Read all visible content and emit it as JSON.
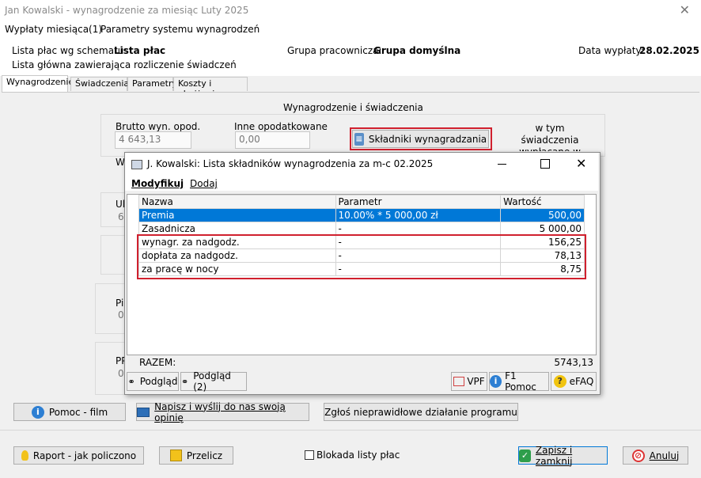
{
  "window": {
    "title": "Jan Kowalski - wynagrodzenie za miesiąc Luty 2025",
    "close_glyph": "✕"
  },
  "menu": {
    "items": [
      "Wypłaty miesiąca(1)",
      "Parametry systemu wynagrodzeń"
    ]
  },
  "header": {
    "schema_label": "Lista płac wg schematu:",
    "schema_value": "Lista płac",
    "schema_desc": "Lista główna zawierająca rozliczenie świadczeń",
    "group_label": "Grupa pracownicza:",
    "group_value": "Grupa domyślna",
    "date_label": "Data wypłaty:",
    "date_value": "28.02.2025"
  },
  "tabs": [
    "Wynagrodzenie",
    "Świadczenia",
    "Parametry",
    "Koszty i obniżenia"
  ],
  "main": {
    "section_title": "Wynagrodzenie i świadczenia",
    "brutto_label": "Brutto wyn. opod.",
    "brutto_value": "4 643,13",
    "inne_label": "Inne opodatkowane",
    "inne_value": "0,00",
    "skladniki_button": "Składniki wynagradzania",
    "w_tym_label": "w tym świadczenia wypłacane w",
    "partial": {
      "w": "W",
      "ul": "Ul",
      "six": "6",
      "pi": "Pi",
      "zero1": "0",
      "pr": "PP",
      "zero2": "0"
    }
  },
  "dialog": {
    "title": "J. Kowalski: Lista składników wynagrodzenia za m-c 02.2025",
    "menu": [
      "Modyfikuj",
      "Dodaj"
    ],
    "columns": [
      "Nazwa",
      "Parametr",
      "Wartość"
    ],
    "rows": [
      {
        "nazwa": "Premia",
        "parametr": "10.00% * 5 000,00 zł",
        "wartosc": "500,00"
      },
      {
        "nazwa": "Zasadnicza",
        "parametr": "-",
        "wartosc": "5 000,00"
      },
      {
        "nazwa": "wynagr. za nadgodz.",
        "parametr": "-",
        "wartosc": "156,25"
      },
      {
        "nazwa": "dopłata za nadgodz.",
        "parametr": "-",
        "wartosc": "78,13"
      },
      {
        "nazwa": "za pracę w nocy",
        "parametr": "-",
        "wartosc": "8,75"
      }
    ],
    "total_label": "RAZEM:",
    "total_value": "5743,13",
    "buttons": {
      "podglad": "Podgląd",
      "podglad2": "Podgląd (2)",
      "vpf": "VPF",
      "pomoc": "F1 Pomoc",
      "efaq": "eFAQ"
    }
  },
  "bottom_row1": {
    "pomoc_film": "Pomoc - film",
    "napisz": "Napisz i wyślij do nas swoją opinię",
    "zglos": "Zgłoś nieprawidłowe działanie programu"
  },
  "bottom_row2": {
    "raport": "Raport - jak policzono",
    "przelicz": "Przelicz",
    "blokada": "Blokada listy płac",
    "zapisz": "Zapisz i zamknij",
    "anuluj": "Anuluj"
  }
}
